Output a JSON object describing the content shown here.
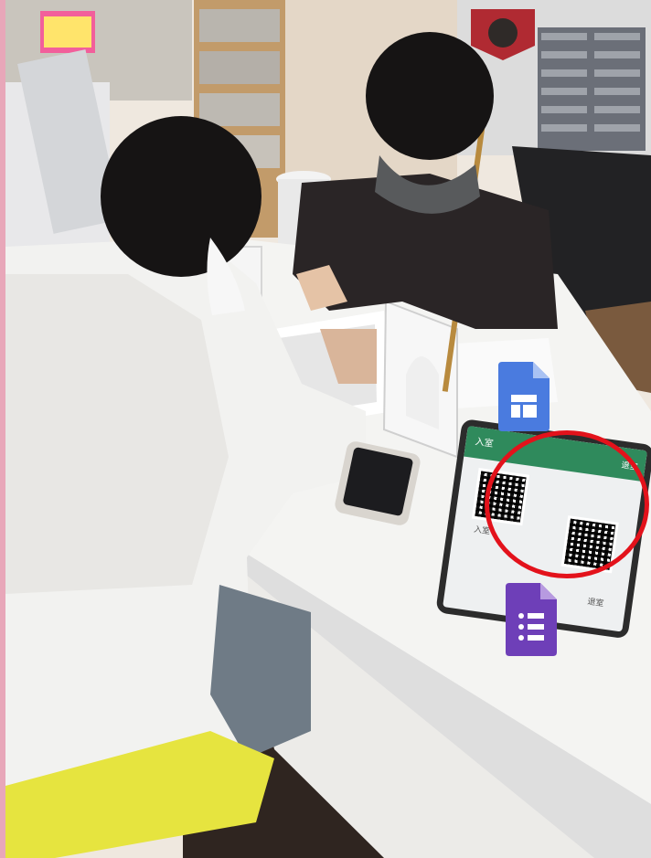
{
  "photo": {
    "tablet": {
      "enter_header": "入室",
      "exit_header": "退室",
      "enter_caption": "入室",
      "exit_caption": "退室"
    },
    "highlight_color": "#e3121b",
    "icons": [
      "google-sites-icon",
      "google-forms-icon"
    ],
    "colors": {
      "sites_blue": "#4a7bdf",
      "forms_purple": "#6e3fb8",
      "tablet_green": "#2f8a5c"
    }
  }
}
